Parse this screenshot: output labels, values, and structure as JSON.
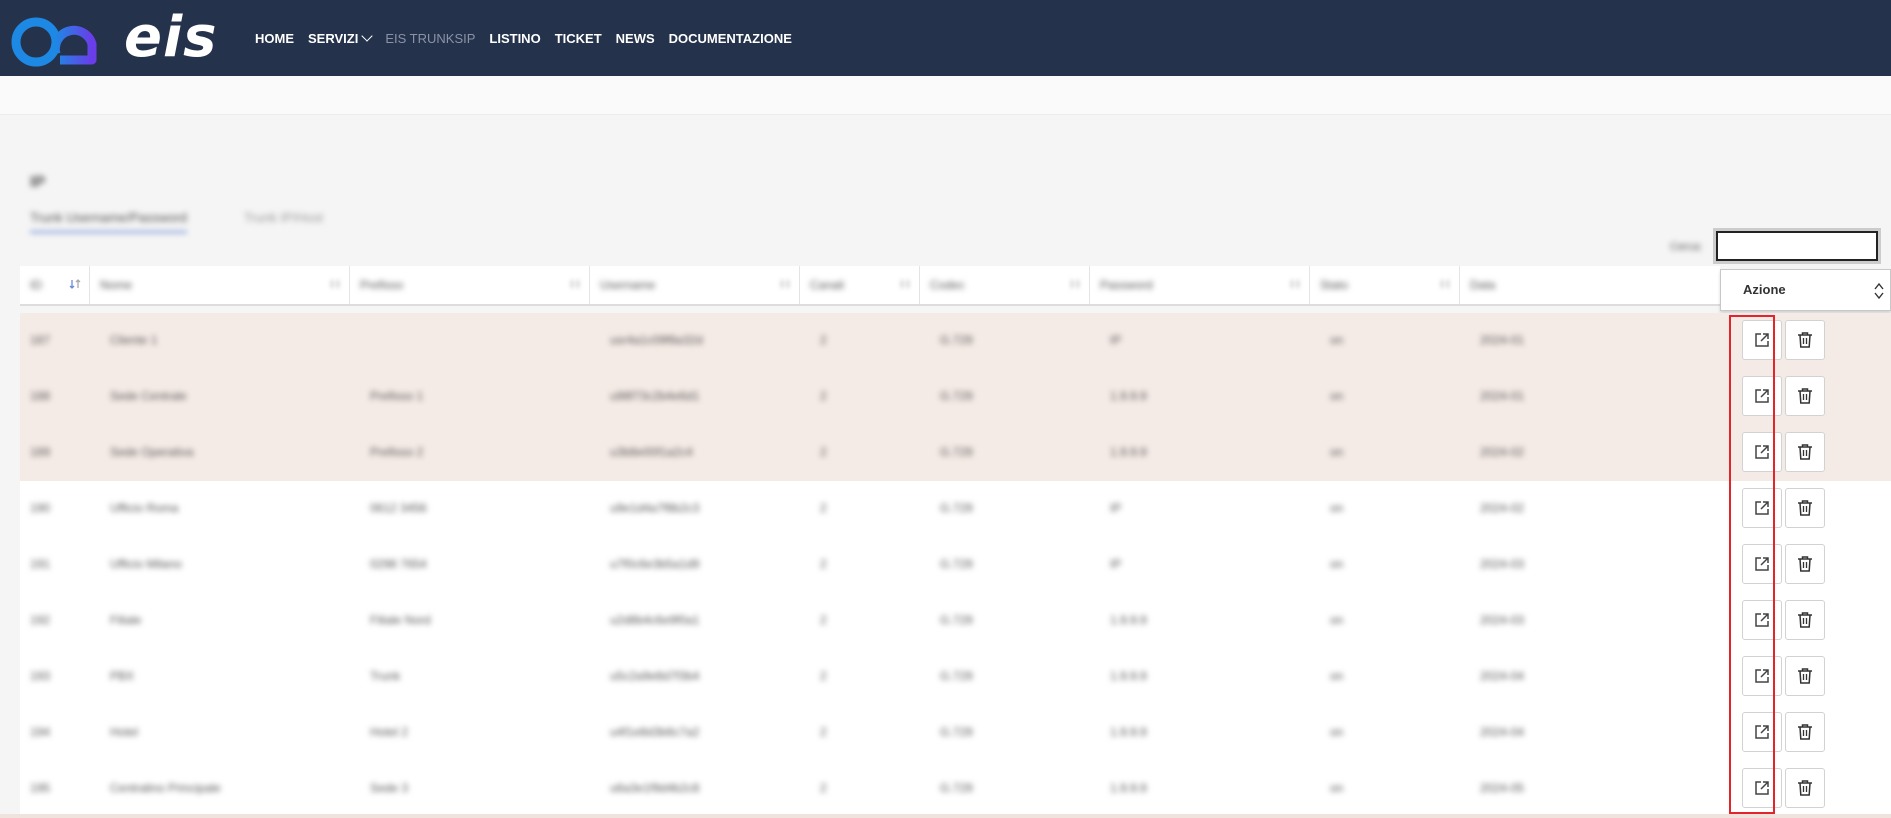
{
  "brand": {
    "name": "eis",
    "accent_blue": "#1e88e5",
    "accent_purple": "#6a3de8",
    "header_bg": "#25324c"
  },
  "nav": {
    "items": [
      {
        "label": "HOME",
        "name": "nav-home",
        "disabled": false,
        "dropdown": false
      },
      {
        "label": "SERVIZI",
        "name": "nav-servizi",
        "disabled": false,
        "dropdown": true
      },
      {
        "label": "EIS TRUNKSIP",
        "name": "nav-eis-trunksip",
        "disabled": true,
        "dropdown": false
      },
      {
        "label": "LISTINO",
        "name": "nav-listino",
        "disabled": false,
        "dropdown": false
      },
      {
        "label": "TICKET",
        "name": "nav-ticket",
        "disabled": false,
        "dropdown": false
      },
      {
        "label": "NEWS",
        "name": "nav-news",
        "disabled": false,
        "dropdown": false
      },
      {
        "label": "DOCUMENTAZIONE",
        "name": "nav-documentazione",
        "disabled": false,
        "dropdown": false
      }
    ]
  },
  "page": {
    "heading": "IP",
    "tabs": [
      {
        "label": "Trunk Username/Password"
      },
      {
        "label": "Trunk IP/Host"
      }
    ],
    "search": {
      "label": "Cerca:",
      "value": "",
      "placeholder": ""
    }
  },
  "table": {
    "columns": [
      "ID",
      "Nome",
      "Prefisso",
      "Username",
      "Canali",
      "Codec",
      "Password",
      "Stato",
      "Data"
    ],
    "action_header": "Azione",
    "rows": [
      {
        "highlight": true,
        "cells": [
          "187",
          "Cliente 1",
          "",
          "usr4a1c09f8a32d",
          "2",
          "G.729",
          "IP",
          "on",
          "2024-01"
        ]
      },
      {
        "highlight": true,
        "cells": [
          "188",
          "Sede Centrale",
          "Prefisso 1",
          "u98f73c2b4e6d1",
          "2",
          "G.729",
          "1.9.9.9",
          "on",
          "2024-01"
        ]
      },
      {
        "highlight": true,
        "cells": [
          "189",
          "Sede Operativa",
          "Prefisso 2",
          "u3b8e00f1a2c4",
          "2",
          "G.729",
          "1.9.9.9",
          "on",
          "2024-02"
        ]
      },
      {
        "highlight": false,
        "cells": [
          "190",
          "Ufficio Roma",
          "0612 3456",
          "u9e1d4a7f8b2c3",
          "2",
          "G.729",
          "IP",
          "on",
          "2024-02"
        ]
      },
      {
        "highlight": false,
        "cells": [
          "191",
          "Ufficio Milano",
          "0298 7654",
          "u7f0c6e3b5a1d9",
          "2",
          "G.729",
          "IP",
          "on",
          "2024-03"
        ]
      },
      {
        "highlight": false,
        "cells": [
          "192",
          "Filiale",
          "Filiale Nord",
          "u2d8b4c6e9f0a1",
          "2",
          "G.729",
          "1.9.9.9",
          "on",
          "2024-03"
        ]
      },
      {
        "highlight": false,
        "cells": [
          "193",
          "PBX",
          "Trunk",
          "u5c2a9e8d7f3b4",
          "2",
          "G.729",
          "1.9.9.9",
          "on",
          "2024-04"
        ]
      },
      {
        "highlight": false,
        "cells": [
          "194",
          "Hotel",
          "Hotel 2",
          "u4f1e8d3b6c7a2",
          "2",
          "G.729",
          "1.9.9.9",
          "on",
          "2024-04"
        ]
      },
      {
        "highlight": false,
        "cells": [
          "195",
          "Centralino Principale",
          "Sede 3",
          "u6a3e1f9d4b2c8",
          "2",
          "G.729",
          "1.9.9.9",
          "on",
          "2024-05"
        ]
      }
    ]
  },
  "icons": {
    "open": "external-link-icon",
    "delete": "trash-icon",
    "sort": "sort-icon"
  }
}
